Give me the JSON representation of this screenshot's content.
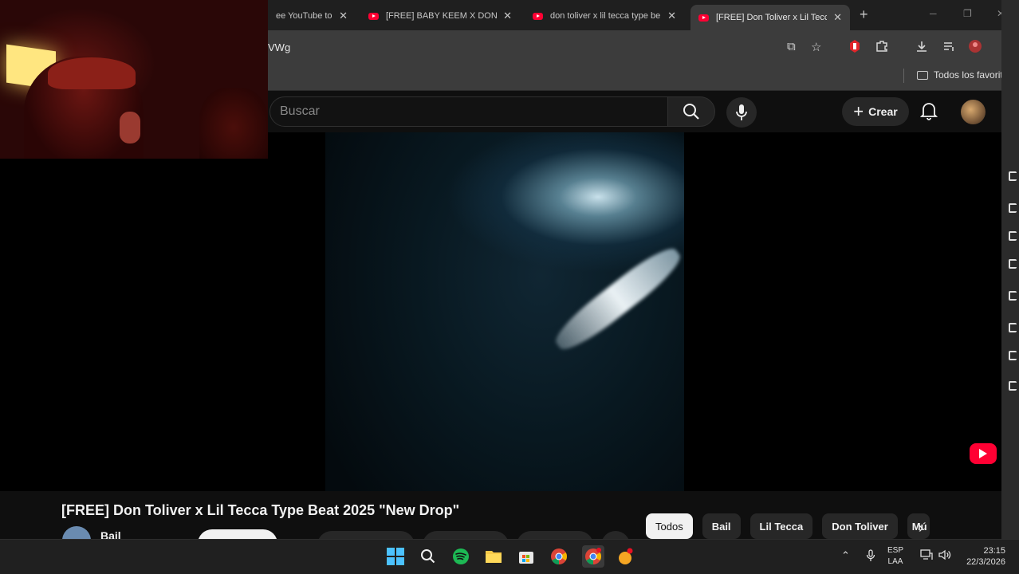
{
  "tabs": [
    {
      "title": "ee YouTube to M",
      "active": false
    },
    {
      "title": "[FREE] BABY KEEM X DON TO",
      "active": false
    },
    {
      "title": "don toliver x lil tecca type be",
      "active": false
    },
    {
      "title": "[FREE] Don Toliver x Lil Tecca",
      "active": true
    }
  ],
  "address_bar": {
    "url": "VWg"
  },
  "bookmarks": {
    "all_favorites": "Todos los favorito"
  },
  "youtube_header": {
    "search_placeholder": "Buscar",
    "create_label": "Crear"
  },
  "video": {
    "title": "[FREE] Don Toliver x Lil Tecca Type Beat 2025 \"New Drop\"",
    "channel": "Bail"
  },
  "chips": [
    "Todos",
    "Bail",
    "Lil Tecca",
    "Don Toliver",
    "Mú"
  ],
  "taskbar": {
    "lang_line1": "ESP",
    "lang_line2": "LAA",
    "time": "23:15",
    "date": "22/3/2026"
  },
  "colors": {
    "youtube_red": "#ff0033",
    "background": "#0f0f0f",
    "chip_bg": "#272727",
    "windows_accent": "#4cc2ff"
  }
}
